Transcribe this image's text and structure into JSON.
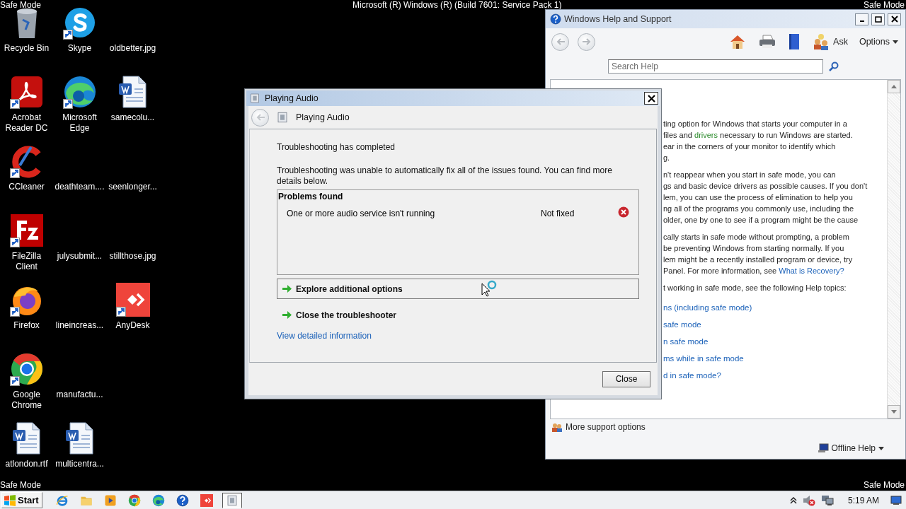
{
  "desktop_overlay": {
    "top_left": "Safe Mode",
    "build": "Microsoft (R) Windows (R) (Build 7601: Service Pack 1)",
    "top_right": "Safe Mode",
    "bottom_left": "Safe Mode",
    "bottom_right": "Safe Mode"
  },
  "desktop_icons": [
    {
      "kind": "recycle-bin",
      "label": "Recycle Bin",
      "shortcut": false
    },
    {
      "kind": "acrobat",
      "label": "Acrobat Reader DC",
      "shortcut": true
    },
    {
      "kind": "ccleaner",
      "label": "CCleaner",
      "shortcut": true
    },
    {
      "kind": "filezilla",
      "label": "FileZilla Client",
      "shortcut": true
    },
    {
      "kind": "firefox",
      "label": "Firefox",
      "shortcut": true
    },
    {
      "kind": "chrome",
      "label": "Google Chrome",
      "shortcut": true
    },
    {
      "kind": "word",
      "label": "atlondon.rtf",
      "shortcut": false
    },
    {
      "kind": "skype",
      "label": "Skype",
      "shortcut": true
    },
    {
      "kind": "edge",
      "label": "Microsoft Edge",
      "shortcut": true
    },
    {
      "kind": "blank",
      "label": "deathteam....",
      "shortcut": false
    },
    {
      "kind": "blank",
      "label": "julysubmit...",
      "shortcut": false
    },
    {
      "kind": "blank",
      "label": "lineincreas...",
      "shortcut": false
    },
    {
      "kind": "blank",
      "label": "manufactu...",
      "shortcut": false
    },
    {
      "kind": "word",
      "label": "multicentra...",
      "shortcut": false
    },
    {
      "kind": "blank",
      "label": "oldbetter.jpg",
      "shortcut": false
    },
    {
      "kind": "word",
      "label": "samecolu...",
      "shortcut": false
    },
    {
      "kind": "blank",
      "label": "seenlonger...",
      "shortcut": false
    },
    {
      "kind": "blank",
      "label": "stillthose.jpg",
      "shortcut": false
    },
    {
      "kind": "anydesk",
      "label": "AnyDesk",
      "shortcut": true
    }
  ],
  "help_window": {
    "title": "Windows Help and Support",
    "ask": "Ask",
    "options": "Options",
    "search": {
      "placeholder": "Search Help"
    },
    "paragraphs": [
      {
        "lines": [
          [
            {
              "kind": "text",
              "text": "ting option for Windows that starts your computer in a"
            }
          ],
          [
            {
              "kind": "text",
              "text": "files and "
            },
            {
              "kind": "term",
              "text": "drivers"
            },
            {
              "kind": "text",
              "text": " necessary to run Windows are started."
            }
          ],
          [
            {
              "kind": "text",
              "text": "ear in the corners of your monitor to identify which"
            }
          ],
          [
            {
              "kind": "text",
              "text": "g."
            }
          ]
        ]
      },
      {
        "lines": [
          [
            {
              "kind": "text",
              "text": "n't reappear when you start in safe mode, you can"
            }
          ],
          [
            {
              "kind": "text",
              "text": "gs and basic device drivers as possible causes. If you don't"
            }
          ],
          [
            {
              "kind": "text",
              "text": "lem, you can use the process of elimination to help you"
            }
          ],
          [
            {
              "kind": "text",
              "text": "ng all of the programs you commonly use, including the"
            }
          ],
          [
            {
              "kind": "text",
              "text": "older, one by one to see if a program might be the cause"
            }
          ]
        ]
      },
      {
        "lines": [
          [
            {
              "kind": "text",
              "text": "cally starts in safe mode without prompting, a problem"
            }
          ],
          [
            {
              "kind": "text",
              "text": "be preventing Windows from starting normally. If you"
            }
          ],
          [
            {
              "kind": "text",
              "text": "lem might be a recently installed program or device, try"
            }
          ],
          [
            {
              "kind": "text",
              "text": "Panel. For more information, see "
            },
            {
              "kind": "link",
              "text": "What is Recovery?"
            }
          ]
        ]
      },
      {
        "lines": [
          [
            {
              "kind": "text",
              "text": "t working in safe mode, see the following Help topics:"
            }
          ]
        ]
      }
    ],
    "topics": [
      "ns (including safe mode)",
      "safe mode",
      "n safe mode",
      "ms while in safe mode",
      "d in safe mode?"
    ],
    "more_support": "More support options",
    "offline_help": "Offline Help"
  },
  "dialog": {
    "title": "Playing Audio",
    "header": "Playing Audio",
    "heading": "Troubleshooting has completed",
    "message": "Troubleshooting was unable to automatically fix all of the issues found. You can find more details below.",
    "problems": {
      "heading": "Problems found",
      "rows": [
        {
          "description": "One or more audio service isn't running",
          "status": "Not fixed",
          "kind": "error"
        }
      ]
    },
    "options": [
      {
        "label": "Explore additional options",
        "selected": true
      },
      {
        "label": "Close the troubleshooter",
        "selected": false
      }
    ],
    "link": "View detailed information",
    "button": "Close"
  },
  "taskbar": {
    "start": "Start",
    "items": [
      {
        "kind": "ie",
        "selected": false
      },
      {
        "kind": "folder",
        "selected": false
      },
      {
        "kind": "media",
        "selected": false
      },
      {
        "kind": "chrome",
        "selected": false
      },
      {
        "kind": "edge",
        "selected": false
      },
      {
        "kind": "help",
        "selected": false
      },
      {
        "kind": "anydesk",
        "selected": false
      },
      {
        "kind": "troubleshooter",
        "selected": true
      }
    ],
    "tray": [
      {
        "kind": "chevron"
      },
      {
        "kind": "speaker-muted"
      },
      {
        "kind": "network"
      }
    ],
    "clock": "5:19 AM"
  }
}
